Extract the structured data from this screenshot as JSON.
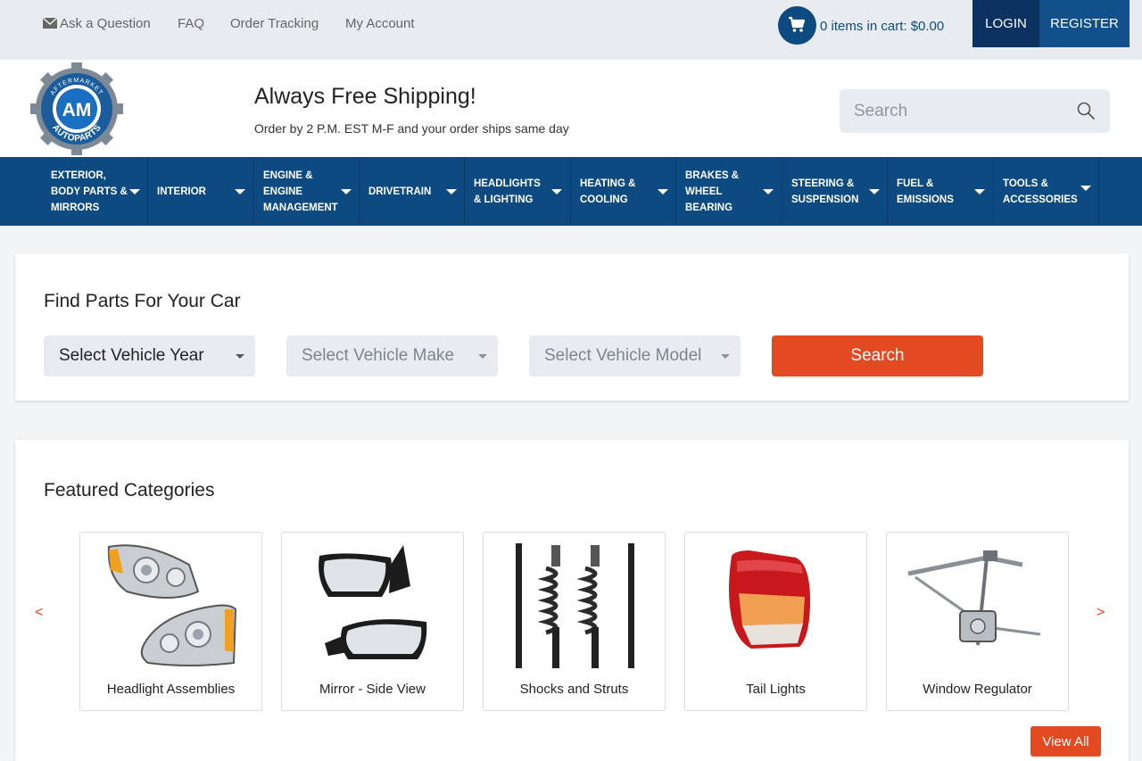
{
  "topbar": {
    "ask_label": "Ask a Question",
    "faq_label": "FAQ",
    "tracking_label": "Order Tracking",
    "account_label": "My Account",
    "cart_text": "0 items in cart: $0.00",
    "login_label": "LOGIN",
    "register_label": "REGISTER"
  },
  "header": {
    "logo_ring_text": "AFTERMARKET",
    "logo_center_text": "AM",
    "logo_bottom_text": "AUTOPARTS",
    "shipping_title": "Always Free Shipping!",
    "shipping_subtitle": "Order by 2 P.M. EST M-F and your order ships same day",
    "search_placeholder": "Search"
  },
  "nav": {
    "items": [
      {
        "label": "Exterior,\nBody Parts &\nMirrors"
      },
      {
        "label": "Interior"
      },
      {
        "label": "Engine &\nEngine\nManagement"
      },
      {
        "label": "Drivetrain"
      },
      {
        "label": "Headlights\n& Lighting"
      },
      {
        "label": "Heating &\nCooling"
      },
      {
        "label": "Brakes &\nWheel\nBearing"
      },
      {
        "label": "Steering &\nSuspension"
      },
      {
        "label": "Fuel &\nEmissions"
      },
      {
        "label": "Tools &\nAccessories"
      }
    ]
  },
  "finder": {
    "title": "Find Parts For Your Car",
    "year_value": "Select Vehicle Year",
    "make_placeholder": "Select Vehicle Make",
    "model_placeholder": "Select Vehicle Model",
    "search_label": "Search"
  },
  "featured": {
    "title": "Featured Categories",
    "prev_arrow": "<",
    "next_arrow": ">",
    "categories": [
      {
        "label": "Headlight Assemblies"
      },
      {
        "label": "Mirror - Side View"
      },
      {
        "label": "Shocks and Struts"
      },
      {
        "label": "Tail Lights"
      },
      {
        "label": "Window Regulator"
      }
    ],
    "view_all_label": "View All"
  },
  "colors": {
    "primary_blue": "#0e4a82",
    "dark_blue": "#0b3260",
    "accent_orange": "#e44a22",
    "topbar_bg": "#e8ecf1"
  },
  "icons": [
    "envelope-icon",
    "cart-icon",
    "search-icon",
    "chevron-down-icon",
    "chevron-left-icon",
    "chevron-right-icon"
  ]
}
